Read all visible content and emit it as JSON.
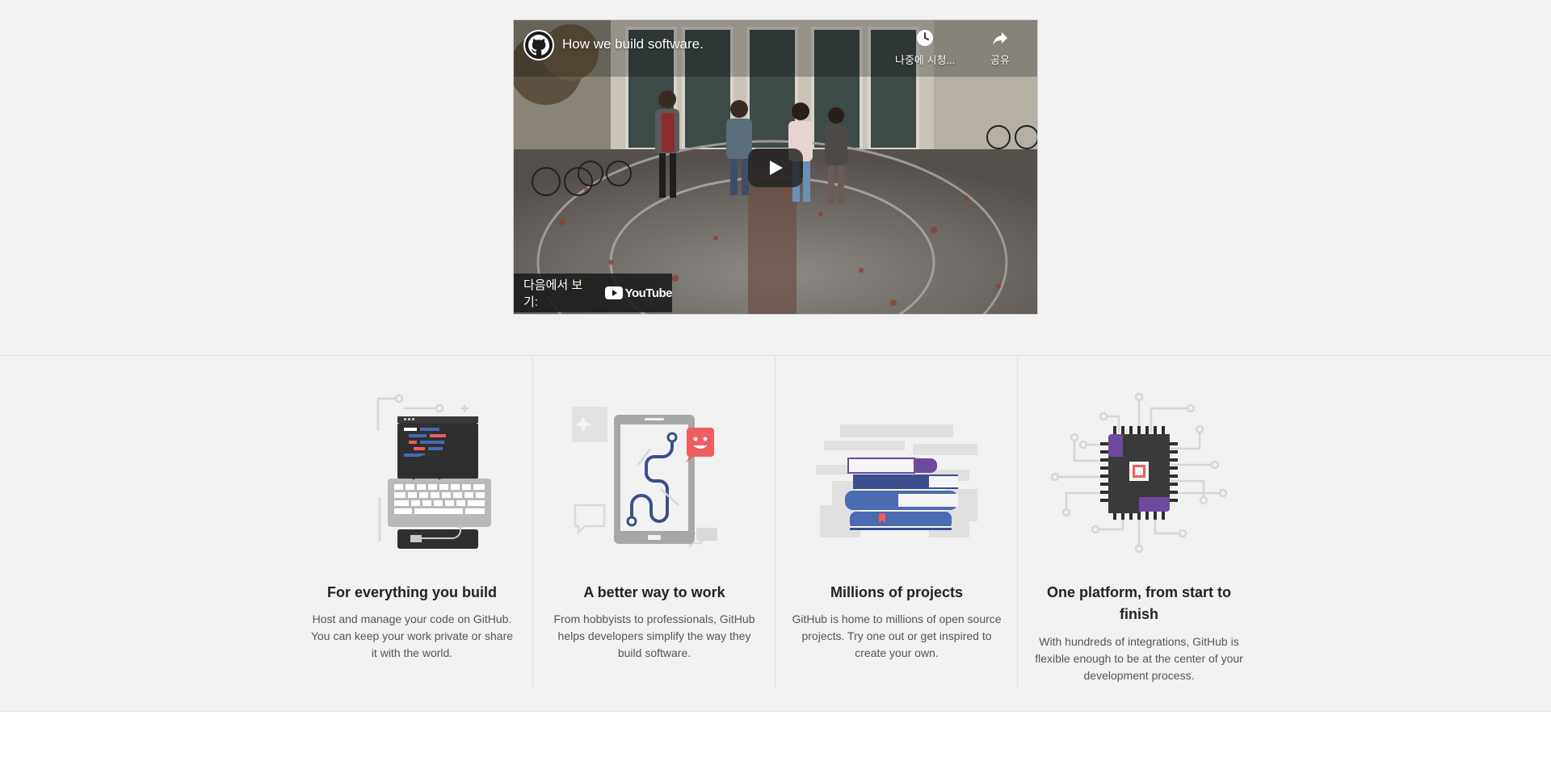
{
  "video": {
    "title": "How we build software.",
    "watch_later_label": "나중에 시청...",
    "share_label": "공유",
    "watch_on_label": "다음에서 보기:",
    "youtube_label": "YouTube"
  },
  "features": [
    {
      "title": "For everything you build",
      "description": "Host and manage your code on GitHub. You can keep your work private or share it with the world.",
      "icon": "keyboard-terminal-icon"
    },
    {
      "title": "A better way to work",
      "description": "From hobbyists to professionals, GitHub helps developers simplify the way they build software.",
      "icon": "tablet-path-icon"
    },
    {
      "title": "Millions of projects",
      "description": "GitHub is home to millions of open source projects. Try one out or get inspired to create your own.",
      "icon": "books-stack-icon"
    },
    {
      "title": "One platform, from start to finish",
      "description": "With hundreds of integrations, GitHub is flexible enough to be at the center of your development process.",
      "icon": "chip-circuit-icon"
    }
  ],
  "colors": {
    "background": "#f2f2f2",
    "accent_red": "#f05d5e",
    "accent_purple": "#6e4a9e",
    "accent_blue": "#4a6ab2"
  }
}
